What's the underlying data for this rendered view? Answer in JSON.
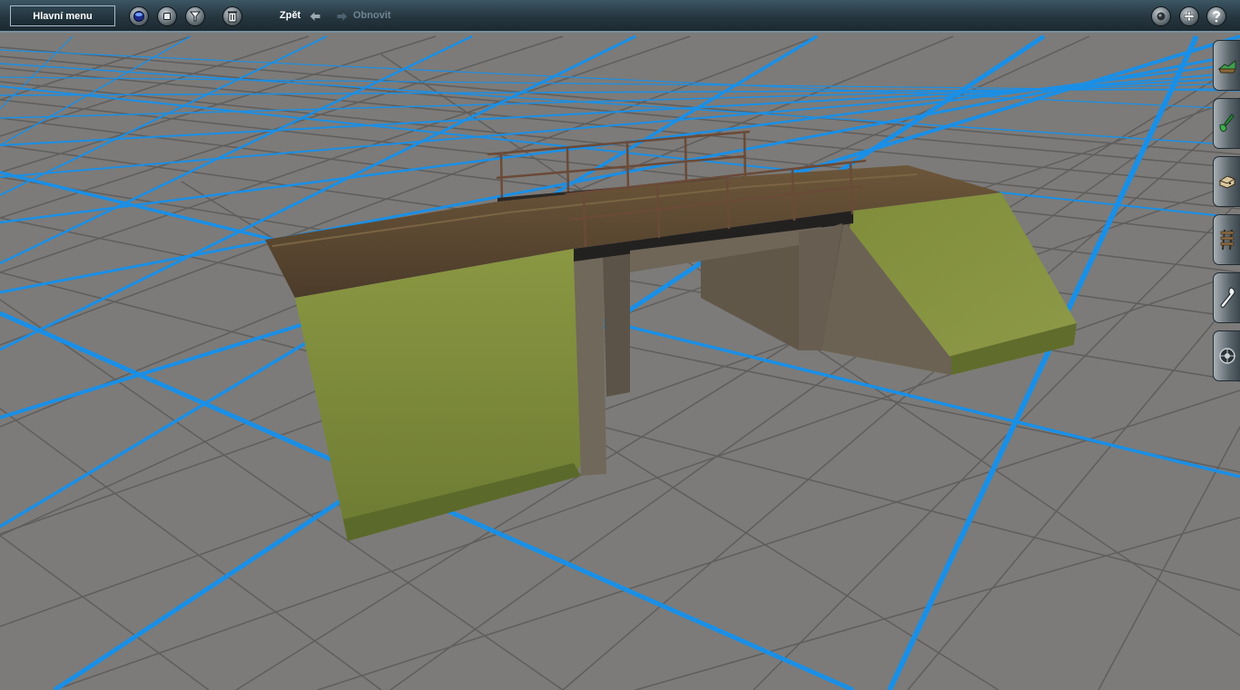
{
  "toolbar": {
    "main_menu_label": "Hlavní menu",
    "tools": [
      {
        "icon": "globe-icon"
      },
      {
        "icon": "stop-icon"
      },
      {
        "icon": "filter-icon"
      },
      {
        "icon": "trash-icon"
      }
    ],
    "undo_label": "Zpět",
    "redo_label": "Obnovit",
    "right_tools": [
      {
        "icon": "record-icon"
      },
      {
        "icon": "plus-icon"
      },
      {
        "icon": "help-icon"
      }
    ]
  },
  "side_tabs": [
    {
      "icon": "terrain-tool-icon"
    },
    {
      "icon": "paint-tool-icon"
    },
    {
      "icon": "objects-tool-icon"
    },
    {
      "icon": "track-tool-icon"
    },
    {
      "icon": "wrench-tool-icon"
    },
    {
      "icon": "settings-tool-icon"
    }
  ],
  "colors": {
    "toolbar_bg": "#26363f",
    "ground": "#7c7b79",
    "grid_major": "#1a8fe6",
    "grid_minor": "#5e5d5b",
    "grass": "#7d8b3a",
    "road": "#5e4a32",
    "stone": "#6e6558",
    "rail": "#6a4a38",
    "undo_text": "#ffffff",
    "redo_text": "#6f8592"
  }
}
